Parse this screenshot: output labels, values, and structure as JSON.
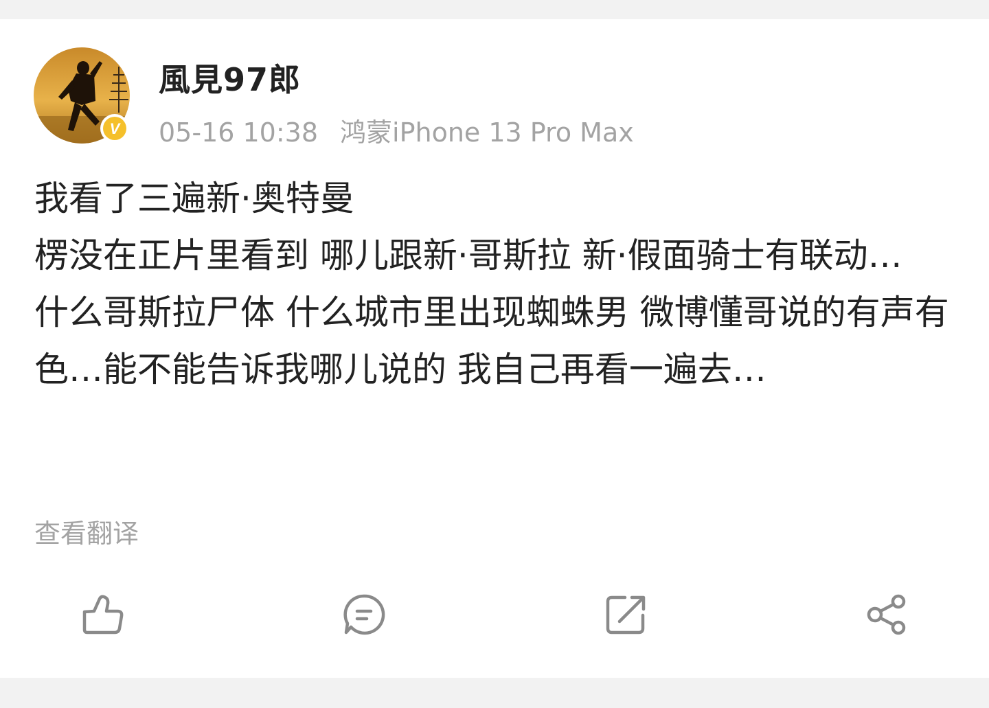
{
  "post": {
    "author": {
      "name": "風見97郎",
      "avatar_icon": "avatar-silhouette-sunset",
      "verified_icon": "verified-badge-icon",
      "verified_mark": "V",
      "verified_color": "#f5c02b"
    },
    "time": "05-16 10:38",
    "source": "鸿蒙iPhone 13 Pro Max",
    "content_lines": [
      "我看了三遍新·奥特曼",
      "楞没在正片里看到 哪儿跟新·哥斯拉 新·假面骑士有联动…",
      "什么哥斯拉尸体 什么城市里出现蜘蛛男 微博懂哥说的有声有色…能不能告诉我哪儿说的 我自己再看一遍去…"
    ],
    "translate_label": "查看翻译"
  },
  "actions": [
    {
      "name": "like-button",
      "icon": "thumbs-up-icon"
    },
    {
      "name": "comment-button",
      "icon": "comment-icon"
    },
    {
      "name": "repost-button",
      "icon": "repost-icon"
    },
    {
      "name": "share-button",
      "icon": "share-icon"
    }
  ],
  "colors": {
    "text_primary": "#222222",
    "text_secondary": "#a3a3a3",
    "icon": "#8a8a8a",
    "background": "#f2f2f2",
    "card": "#ffffff"
  }
}
